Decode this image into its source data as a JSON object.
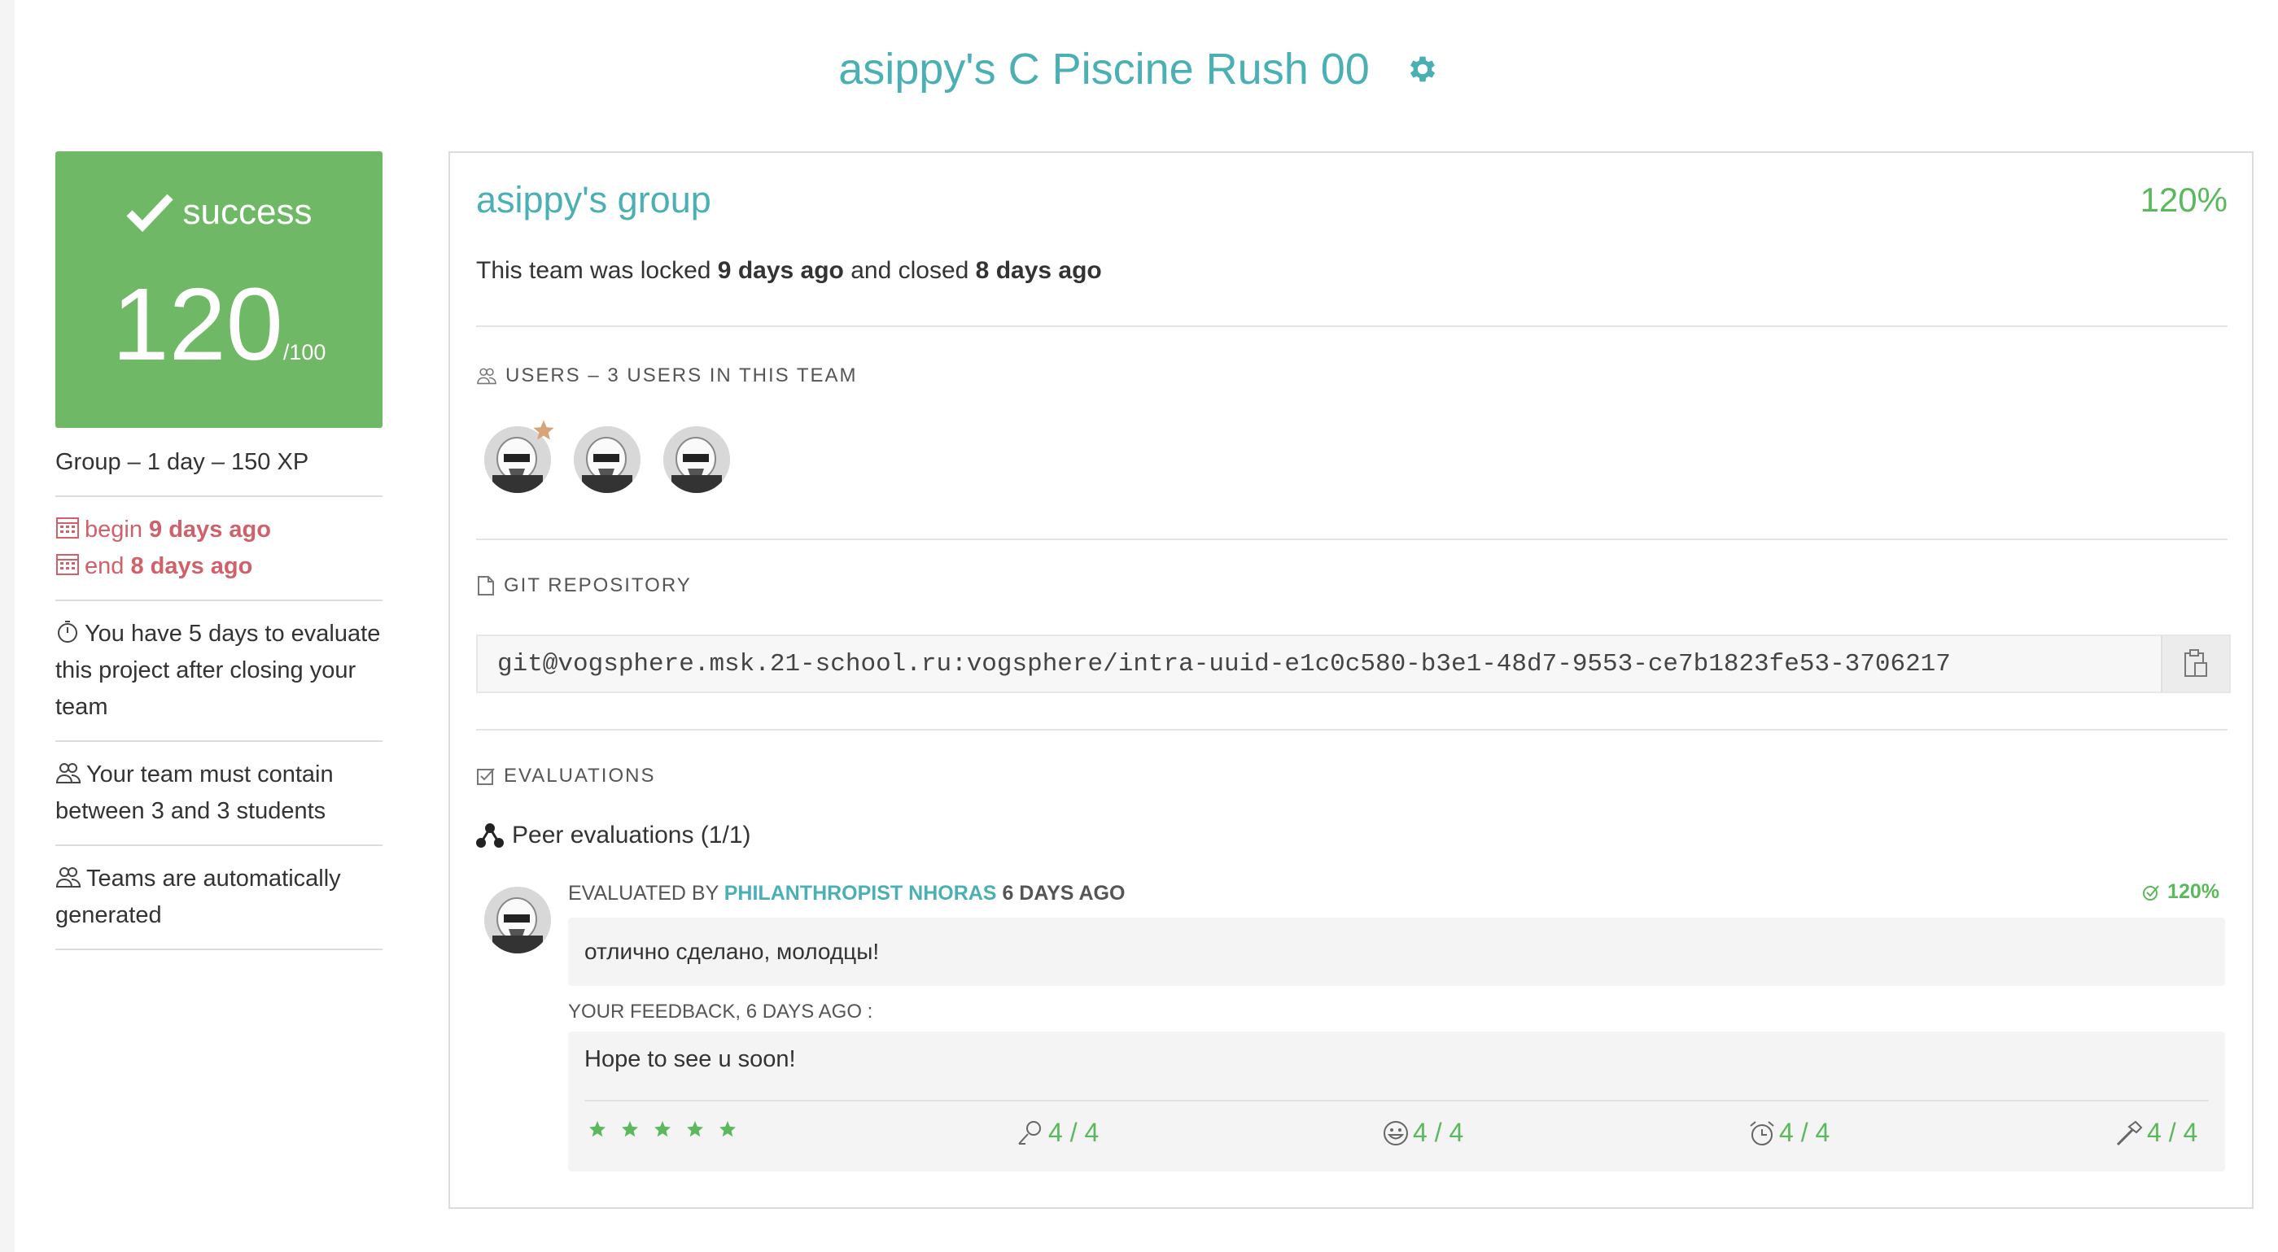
{
  "page": {
    "title": "asippy's C Piscine Rush 00",
    "settings_icon": "gear-icon"
  },
  "colors": {
    "accent": "#4ab0b4",
    "success": "#5cb85c",
    "score_bg": "#6fb865",
    "danger": "#d0606a"
  },
  "score": {
    "status": "success",
    "value": "120",
    "max": "/100"
  },
  "project_info": {
    "meta": "Group – 1 day – 150 XP",
    "begin_label": "begin",
    "begin_value": "9 days ago",
    "end_label": "end",
    "end_value": "8 days ago",
    "evaluate_note": "You have 5 days to evaluate this project after closing your team",
    "team_size_note": "Your team must contain between 3 and 3 students",
    "auto_note": "Teams are automatically generated"
  },
  "group": {
    "title": "asippy's group",
    "percent": "120%",
    "locked_prefix": "This team was locked",
    "locked_value": "9 days ago",
    "closed_prefix": "and closed",
    "closed_value": "8 days ago"
  },
  "users": {
    "label": "USERS – 3 USERS IN THIS TEAM",
    "count": 3
  },
  "git": {
    "label": "GIT REPOSITORY",
    "url": "git@vogsphere.msk.21-school.ru:vogsphere/intra-uuid-e1c0c580-b3e1-48d7-9553-ce7b1823fe53-3706217"
  },
  "evaluations": {
    "label": "EVALUATIONS",
    "peer_title": "Peer evaluations (1/1)",
    "items": [
      {
        "by_prefix": "EVALUATED BY",
        "evaluator": "PHILANTHROPIST NHORAS",
        "when": "6 DAYS AGO",
        "percent": "120%",
        "comment": "отлично сделано, молодцы!",
        "feedback_label": "YOUR FEEDBACK, 6 DAYS AGO :",
        "feedback": "Hope to see u soon!",
        "rating_stars": 5,
        "metrics": [
          {
            "icon": "interest-icon",
            "value": "4 / 4"
          },
          {
            "icon": "smiley-icon",
            "value": "4 / 4"
          },
          {
            "icon": "alarm-clock-icon",
            "value": "4 / 4"
          },
          {
            "icon": "hammer-icon",
            "value": "4 / 4"
          }
        ]
      }
    ]
  }
}
